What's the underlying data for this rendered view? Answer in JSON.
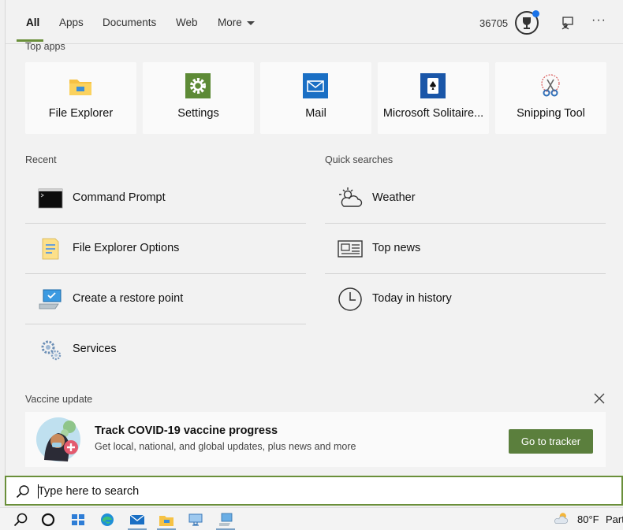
{
  "nav": {
    "tabs": [
      {
        "label": "All",
        "active": true
      },
      {
        "label": "Apps"
      },
      {
        "label": "Documents"
      },
      {
        "label": "Web"
      },
      {
        "label": "More"
      }
    ],
    "points": "36705",
    "icons": [
      "trophy-icon",
      "feedback-icon",
      "more-options-icon"
    ],
    "accent": "#6a8f3a"
  },
  "top_apps": {
    "title": "Top apps",
    "items": [
      {
        "label": "File Explorer",
        "icon": "folder-icon"
      },
      {
        "label": "Settings",
        "icon": "gear-icon"
      },
      {
        "label": "Mail",
        "icon": "mail-icon"
      },
      {
        "label": "Microsoft Solitaire...",
        "icon": "cards-icon"
      },
      {
        "label": "Snipping Tool",
        "icon": "scissors-icon"
      }
    ]
  },
  "recent": {
    "title": "Recent",
    "items": [
      {
        "label": "Command Prompt",
        "icon": "command-prompt-icon"
      },
      {
        "label": "File Explorer Options",
        "icon": "folder-options-icon"
      },
      {
        "label": "Create a restore point",
        "icon": "system-restore-icon"
      },
      {
        "label": "Services",
        "icon": "services-gear-icon"
      }
    ]
  },
  "quick_searches": {
    "title": "Quick searches",
    "items": [
      {
        "label": "Weather",
        "icon": "weather-icon"
      },
      {
        "label": "Top news",
        "icon": "news-icon"
      },
      {
        "label": "Today in history",
        "icon": "clock-icon"
      }
    ]
  },
  "vaccine": {
    "title": "Vaccine update",
    "card_title": "Track COVID-19 vaccine progress",
    "card_subtitle": "Get local, national, and global updates, plus news and more",
    "button": "Go to tracker",
    "button_color": "#5b7f3d"
  },
  "search": {
    "placeholder": "Type here to search"
  },
  "taskbar": {
    "icons": [
      "search-icon",
      "cortana-icon",
      "task-view-icon",
      "edge-icon",
      "mail-icon",
      "file-explorer-icon",
      "remote-desktop-icon",
      "system-restore-icon"
    ],
    "weather_temp": "80°F",
    "weather_cond": "Part"
  }
}
